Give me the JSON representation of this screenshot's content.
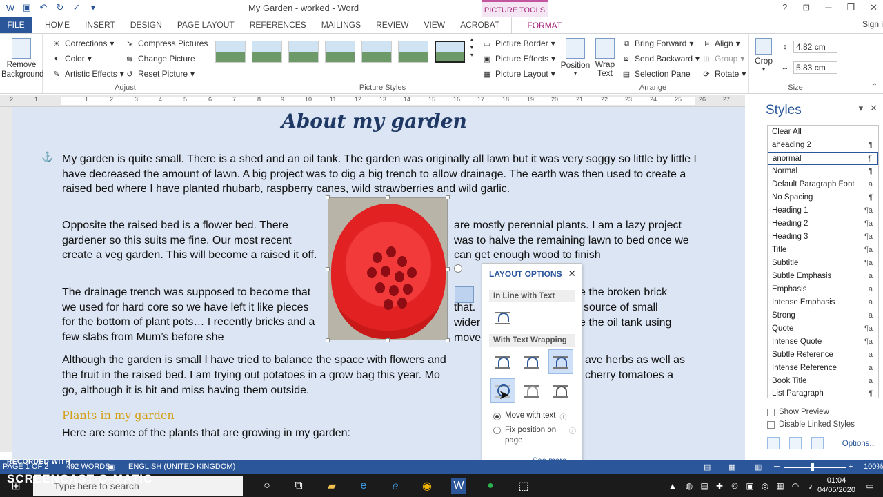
{
  "window": {
    "title": "My Garden - worked - Word",
    "picture_tools": "PICTURE TOOLS",
    "sign_in": "Sign i"
  },
  "tabs": [
    "FILE",
    "HOME",
    "INSERT",
    "DESIGN",
    "PAGE LAYOUT",
    "REFERENCES",
    "MAILINGS",
    "REVIEW",
    "VIEW",
    "ACROBAT",
    "FORMAT"
  ],
  "ribbon": {
    "remove_background": "Remove Background",
    "adjust": {
      "label": "Adjust",
      "corrections": "Corrections",
      "color": "Color",
      "artistic": "Artistic Effects",
      "compress": "Compress Pictures",
      "change": "Change Picture",
      "reset": "Reset Picture"
    },
    "picture_styles": {
      "label": "Picture Styles",
      "border": "Picture Border",
      "effects": "Picture Effects",
      "layout": "Picture Layout"
    },
    "arrange": {
      "label": "Arrange",
      "position": "Position",
      "wrap_text": "Wrap Text",
      "bring_forward": "Bring Forward",
      "send_backward": "Send Backward",
      "selection_pane": "Selection Pane",
      "align": "Align",
      "group": "Group",
      "rotate": "Rotate"
    },
    "size": {
      "label": "Size",
      "crop": "Crop",
      "height": "4.82 cm",
      "width": "5.83 cm"
    }
  },
  "ruler_numbers": [
    "2",
    "1",
    "1",
    "2",
    "3",
    "4",
    "5",
    "6",
    "7",
    "8",
    "9",
    "10",
    "11",
    "12",
    "13",
    "14",
    "15",
    "16",
    "17",
    "18",
    "19",
    "20",
    "21",
    "22",
    "23",
    "24",
    "25",
    "26",
    "27"
  ],
  "document": {
    "heading": "About my garden",
    "para1": "My garden is quite small. There is a shed and an oil tank.  The garden was originally all lawn but it was very soggy so little by little I have decreased the amount of lawn. A big project was to dig a big trench to allow drainage.  The earth was then used to create a raised bed where I have planted rhubarb, raspberry canes, wild strawberries and wild garlic.",
    "para2_left": "Opposite the raised bed is a flower bed. There gardener so this suits me fine. Our most recent create a veg garden.  This will become a raised it off.",
    "para2_right": "are mostly perennial plants. I am a lazy project was to halve the remaining lawn to bed once we can get enough wood to finish",
    "para3_left": "The drainage trench was supposed to become that we used for hard core so we have left it like pieces for the bottom of plant pots… I recently bricks and a few slabs from Mum’s before she",
    "para3_right_a": "e the broken brick",
    "para3_right_b": "that.",
    "para3_right_c": "source of small",
    "para3_right_d": "wider",
    "para3_right_e": "e the oil tank using",
    "para3_right_f": "move",
    "para4_a": "Although the garden is small I have tried to balance the space with flowers and",
    "para4_b": "ave herbs as well as",
    "para4_c": "the fruit in the raised bed.  I am trying out potatoes in a grow bag this year.  Mo",
    "para4_d": "cherry tomatoes a",
    "para4_e": "go, although it is hit and miss having them outside.",
    "subheading": "Plants in my garden",
    "para5": "Here are some of the plants that are growing in my garden:"
  },
  "layout_options": {
    "title": "LAYOUT OPTIONS",
    "inline": "In Line with Text",
    "with_wrapping": "With Text Wrapping",
    "move_with_text": "Move with text",
    "fix_position": "Fix position on page",
    "see_more": "See more..."
  },
  "styles_pane": {
    "title": "Styles",
    "items": [
      {
        "name": "Clear All",
        "mark": ""
      },
      {
        "name": "aheading 2",
        "mark": "¶"
      },
      {
        "name": "anormal",
        "mark": "¶"
      },
      {
        "name": "Normal",
        "mark": "¶"
      },
      {
        "name": "Default Paragraph Font",
        "mark": "a"
      },
      {
        "name": "No Spacing",
        "mark": "¶"
      },
      {
        "name": "Heading 1",
        "mark": "¶a"
      },
      {
        "name": "Heading 2",
        "mark": "¶a"
      },
      {
        "name": "Heading 3",
        "mark": "¶a"
      },
      {
        "name": "Title",
        "mark": "¶a"
      },
      {
        "name": "Subtitle",
        "mark": "¶a"
      },
      {
        "name": "Subtle Emphasis",
        "mark": "a"
      },
      {
        "name": "Emphasis",
        "mark": "a"
      },
      {
        "name": "Intense Emphasis",
        "mark": "a"
      },
      {
        "name": "Strong",
        "mark": "a"
      },
      {
        "name": "Quote",
        "mark": "¶a"
      },
      {
        "name": "Intense Quote",
        "mark": "¶a"
      },
      {
        "name": "Subtle Reference",
        "mark": "a"
      },
      {
        "name": "Intense Reference",
        "mark": "a"
      },
      {
        "name": "Book Title",
        "mark": "a"
      },
      {
        "name": "List Paragraph",
        "mark": "¶"
      }
    ],
    "show_preview": "Show Preview",
    "disable_linked": "Disable Linked Styles",
    "options": "Options..."
  },
  "status": {
    "page": "PAGE 1 OF 2",
    "words": "492 WORDS",
    "language": "ENGLISH (UNITED KINGDOM)",
    "zoom": "100%",
    "recorded_with": "RECORDED WITH"
  },
  "taskbar": {
    "brand": "SCREENCAST-O-MATIC",
    "search_placeholder": "Type here to search",
    "time": "01:04",
    "date": "04/05/2020"
  }
}
